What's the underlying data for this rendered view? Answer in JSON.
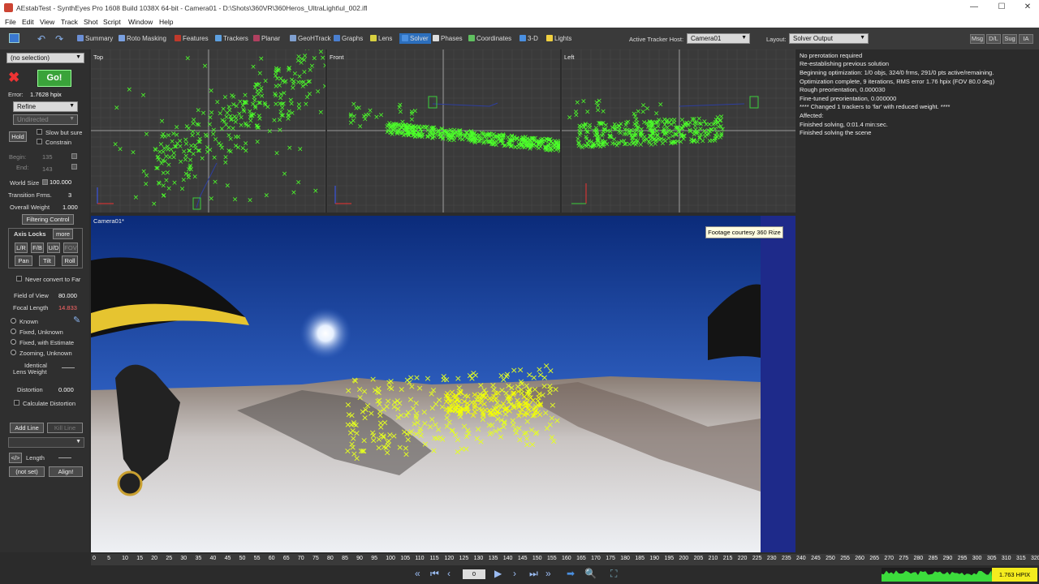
{
  "window": {
    "title": "AEstabTest - SynthEyes Pro 1608 Build 1038X 64-bit - Camera01 - D:\\Shots\\360VR\\360Heros_UltraLight\\ul_002.ifl",
    "minimize": "—",
    "maximize": "☐",
    "close": "✕"
  },
  "menu": [
    "File",
    "Edit",
    "View",
    "Track",
    "Shot",
    "Script",
    "Window",
    "Help"
  ],
  "toolbar": {
    "rooms": [
      {
        "label": "Summary",
        "icon": "summary-icon",
        "color": "#6b8fd6"
      },
      {
        "label": "Roto Masking",
        "icon": "roto-icon",
        "color": "#7aa0e0"
      },
      {
        "label": "Features",
        "icon": "features-icon",
        "color": "#c0392b"
      },
      {
        "label": "Trackers",
        "icon": "trackers-icon",
        "color": "#5da0e0"
      },
      {
        "label": "Planar",
        "icon": "planar-icon",
        "color": "#b04060"
      },
      {
        "label": "GeoHTrack",
        "icon": "geohtrack-icon",
        "color": "#80a0d0"
      },
      {
        "label": "Graphs",
        "icon": "graphs-icon",
        "color": "#4a7fd0"
      },
      {
        "label": "Lens",
        "icon": "lens-icon",
        "color": "#d8d040"
      },
      {
        "label": "Solver",
        "icon": "solver-icon",
        "color": "#4a8fe0"
      },
      {
        "label": "Phases",
        "icon": "phases-icon",
        "color": "#ddd"
      },
      {
        "label": "Coordinates",
        "icon": "coordinates-icon",
        "color": "#60c060"
      },
      {
        "label": "3-D",
        "icon": "3d-icon",
        "color": "#4a8fe0"
      },
      {
        "label": "Lights",
        "icon": "lights-icon",
        "color": "#f0d040"
      }
    ],
    "active_room": "Solver",
    "tracker_host_label": "Active Tracker Host:",
    "tracker_host_value": "Camera01",
    "layout_label": "Layout:",
    "layout_value": "Solver Output",
    "right_buttons": [
      "Msg",
      "D/L",
      "Sug",
      "IA"
    ]
  },
  "left": {
    "selection": "(no selection)",
    "go_label": "Go!",
    "error_label": "Error:",
    "error_value": "1.7628 hpix",
    "mode": "Refine",
    "direction": "Undirected",
    "hold_label": "Hold",
    "slow_label": "Slow but sure",
    "constrain_label": "Constrain",
    "begin_label": "Begin:",
    "begin_value": "135",
    "end_label": "End:",
    "end_value": "143",
    "world_size_label": "World Size",
    "world_size_value": "100.000",
    "transition_label": "Transition Frms.",
    "transition_value": "3",
    "overall_weight_label": "Overall Weight",
    "overall_weight_value": "1.000",
    "filtering_label": "Filtering Control",
    "axis_locks_label": "Axis Locks",
    "more_label": "more",
    "lock_buttons_row1": [
      "L/R",
      "F/B",
      "U/D",
      "FOV"
    ],
    "lock_buttons_row2": [
      "Pan",
      "Tilt",
      "Roll"
    ],
    "never_far_label": "Never convert to Far",
    "fov_label": "Field of View",
    "fov_value": "80.000",
    "focal_label": "Focal Length",
    "focal_value": "14.833",
    "lens_modes": [
      "Known",
      "Fixed, Unknown",
      "Fixed, with Estimate",
      "Zooming, Unknown"
    ],
    "identical_label": "Identical",
    "lens_weight_label": "Lens Weight",
    "distortion_label": "Distortion",
    "distortion_value": "0.000",
    "calc_distortion_label": "Calculate Distortion",
    "add_line_label": "Add Line",
    "kill_line_label": "Kill Line",
    "length_icon": "</>",
    "length_label": "Length",
    "not_set_label": "(not set)",
    "align_label": "Align!"
  },
  "views": {
    "top": "Top",
    "front": "Front",
    "left": "Left",
    "camera": "Camera01*"
  },
  "overlay_note": "Footage courtesy 360 Rize",
  "log": [
    "No prerotation required",
    "Re-establishing previous solution",
    "Beginning optimization: 1/0 objs, 324/0 frms, 291/0 pts active/remaining.",
    "Optimization complete, 9 iterations, RMS error 1.76 hpix (FOV 80.0 deg)",
    "Rough preorientation, 0.000030",
    "Fine-tuned preorientation, 0.000000",
    "**** Changed 1 trackers to 'far' with reduced weight. ****",
    "Affected:",
    "Finished solving, 0:01.4 min:sec.",
    "Finished solving the scene"
  ],
  "timeline": {
    "ticks": [
      "0",
      "5",
      "10",
      "15",
      "20",
      "25",
      "30",
      "35",
      "40",
      "45",
      "50",
      "55",
      "60",
      "65",
      "70",
      "75",
      "80",
      "85",
      "90",
      "95",
      "100",
      "105",
      "110",
      "115",
      "120",
      "125",
      "130",
      "135",
      "140",
      "145",
      "150",
      "155",
      "160",
      "165",
      "170",
      "175",
      "180",
      "185",
      "190",
      "195",
      "200",
      "205",
      "210",
      "215",
      "220",
      "225",
      "230",
      "235",
      "240",
      "245",
      "250",
      "255",
      "260",
      "265",
      "270",
      "275",
      "280",
      "285",
      "290",
      "295",
      "300",
      "305",
      "310",
      "315",
      "320"
    ]
  },
  "playback": {
    "frame": "0",
    "status": "1.763 HPIX"
  },
  "colors": {
    "accent": "#2c6fbd",
    "go": "#3aa33a",
    "tracker": "#4cff2a",
    "status": "#f4ec1e"
  }
}
